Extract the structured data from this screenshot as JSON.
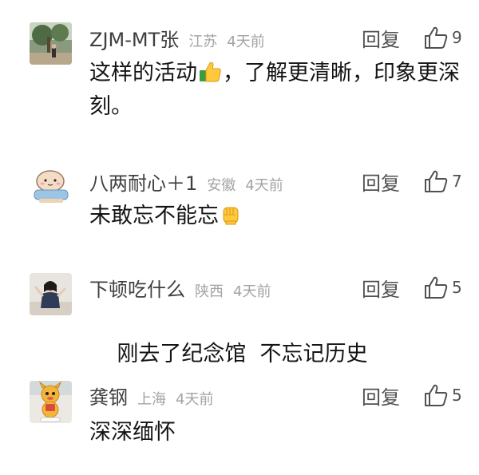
{
  "comments": [
    {
      "username": "ZJM-MT张",
      "region": "江苏",
      "time": "4天前",
      "reply_label": "回复",
      "likes": "9",
      "content_before_emoji": "这样的活动",
      "content_emoji": "thumbs-up-emoji",
      "content_after_emoji": "，了解更清晰，印象更深刻。"
    },
    {
      "username": "八两耐心＋1",
      "region": "安徽",
      "time": "4天前",
      "reply_label": "回复",
      "likes": "7",
      "content_before_emoji": "未敢忘不能忘",
      "content_emoji": "raised-fist-emoji"
    },
    {
      "username": "下顿吃什么",
      "region": "陕西",
      "time": "4天前",
      "reply_label": "回复",
      "likes": "5",
      "content_before_emoji": "刚去了纪念馆  不忘记历史"
    },
    {
      "username": "龚钢",
      "region": "上海",
      "time": "4天前",
      "reply_label": "回复",
      "likes": "5",
      "content_before_emoji": "深深缅怀"
    }
  ],
  "colors": {
    "username": "#3f3f3f",
    "meta": "#a3a3a3",
    "action": "#505050",
    "content": "#141414"
  }
}
